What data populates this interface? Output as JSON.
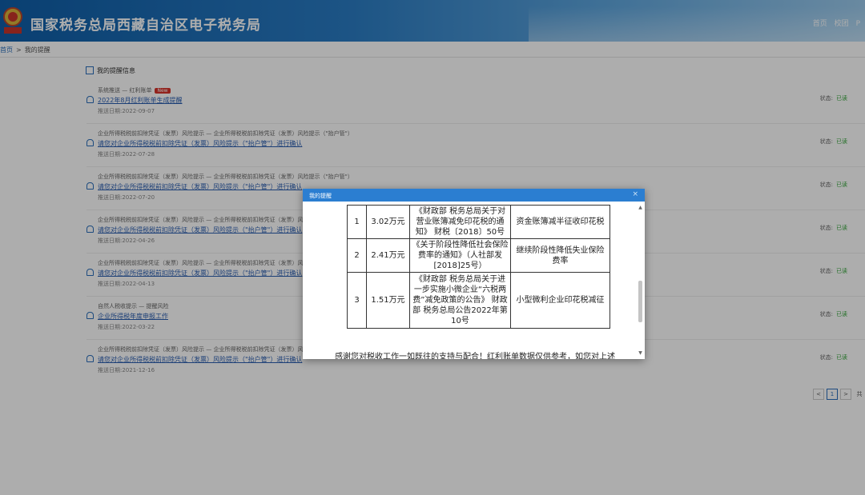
{
  "header": {
    "site_title": "国家税务总局西藏自治区电子税务局",
    "nav": [
      "首页",
      "校团",
      "P"
    ]
  },
  "breadcrumb": {
    "home": "首页",
    "separator": ">",
    "current": "我的提醒"
  },
  "section": {
    "title": "我的提醒信息"
  },
  "messages": [
    {
      "category": "系统推送 — 红利账单",
      "new_badge": "New",
      "title": "2022年8月红利账单生成提醒",
      "date": "推送日期:2022-09-07",
      "status_label": "状态:",
      "status": "已读"
    },
    {
      "category": "企业所得税税前扣除凭证（发票）风险提示 — 企业所得税税前扣除凭证（发票）风险提示（\"抬户管\"）",
      "title": "请您对企业所得税税前扣除凭证（发票）风险提示（\"抬户管\"）进行确认",
      "date": "推送日期:2022-07-28",
      "status_label": "状态:",
      "status": "已读"
    },
    {
      "category": "企业所得税税前扣除凭证（发票）风险提示 — 企业所得税税前扣除凭证（发票）风险提示（\"抬户管\"）",
      "title": "请您对企业所得税税前扣除凭证（发票）风险提示（\"抬户管\"）进行确认",
      "date": "推送日期:2022-07-20",
      "status_label": "状态:",
      "status": "已读"
    },
    {
      "category": "企业所得税税前扣除凭证（发票）风险提示 — 企业所得税税前扣除凭证（发票）风险提示（",
      "title": "请您对企业所得税税前扣除凭证（发票）风险提示（\"抬户管\"）进行确认",
      "date": "推送日期:2022-04-26",
      "status_label": "状态:",
      "status": "已读"
    },
    {
      "category": "企业所得税税前扣除凭证（发票）风险提示 — 企业所得税税前扣除凭证（发票）风险提示（",
      "title": "请您对企业所得税税前扣除凭证（发票）风险提示（\"抬户管\"）进行确认",
      "date": "推送日期:2022-04-13",
      "status_label": "状态:",
      "status": "已读"
    },
    {
      "category": "自然人税收提示 — 提醒风险",
      "title": "企业所得税年度申报工作",
      "date": "推送日期:2022-03-22",
      "status_label": "状态:",
      "status": "已读"
    },
    {
      "category": "企业所得税税前扣除凭证（发票）风险提示 — 企业所得税税前扣除凭证（发票）风险提示（",
      "title": "请您对企业所得税税前扣除凭证（发票）风险提示（\"抬户管\"）进行确认",
      "date": "推送日期:2021-12-16",
      "status_label": "状态:",
      "status": "已读"
    }
  ],
  "pager": {
    "prev": "<",
    "current": "1",
    "next": ">",
    "tail": "共"
  },
  "dialog": {
    "title": "我的提醒",
    "close": "×",
    "rows": [
      {
        "no": "1",
        "amount": "3.02万元",
        "policy": "《财政部 税务总局关于对营业账簿减免印花税的通知》 财税〔2018〕50号",
        "item": "资金账簿减半征收印花税"
      },
      {
        "no": "2",
        "amount": "2.41万元",
        "policy": "《关于阶段性降低社会保险费率的通知》（人社部发[2018]25号）",
        "item": "继续阶段性降低失业保险费率"
      },
      {
        "no": "3",
        "amount": "1.51万元",
        "policy": "《财政部 税务总局关于进一步实施小微企业“六税两费”减免政策的公告》 财政部 税务总局公告2022年第10号",
        "item": "小型微利企业印花税减征"
      }
    ],
    "thanks": "感谢您对税收工作一如既往的支持与配合！红利账单数据仅供参考，如您对上述数据有任何疑问，欢迎向您的主管税务机关咨询。"
  },
  "colors": {
    "header_blue": "#0f5ea8",
    "dialog_head": "#2b7ed1",
    "link": "#2a5db0",
    "read_status": "#35a63a",
    "new_badge": "#d9342b"
  }
}
